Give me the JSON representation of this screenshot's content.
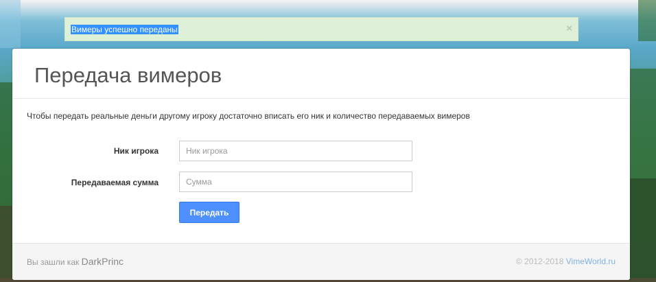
{
  "alert": {
    "message": "Вимеры успешно переданы",
    "close_symbol": "×",
    "color": "#dff0d8"
  },
  "panel": {
    "title": "Передача вимеров",
    "intro": "Чтобы передать реальные деньги другому игроку достаточно вписать его ник и количество передаваемых вимеров"
  },
  "form": {
    "nick_label": "Ник игрока",
    "nick_placeholder": "Ник игрока",
    "nick_value": "",
    "sum_label": "Передаваемая сумма",
    "sum_placeholder": "Сумма",
    "sum_value": "",
    "submit_label": "Передать",
    "submit_color": "#4d90fe"
  },
  "footer": {
    "logged_in_prefix": "Вы зашли как",
    "username": "DarkPrinc",
    "copyright": "© 2012-2018",
    "site_link": "VimeWorld.ru"
  }
}
